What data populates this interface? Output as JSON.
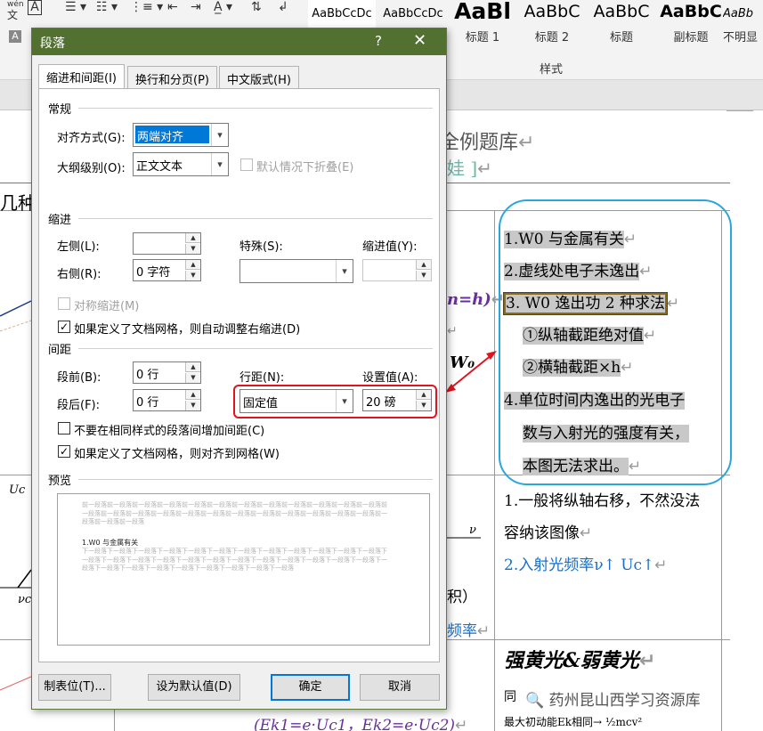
{
  "ribbon": {
    "wen_char": "wén",
    "wen_char_sub": "文",
    "a_char": "A",
    "styles_group_label": "样式",
    "styles": [
      {
        "sample": "AaBbCcDc",
        "name": ""
      },
      {
        "sample": "AaBbCcDc",
        "name": ""
      },
      {
        "sample": "AaBl",
        "name": "标题 1"
      },
      {
        "sample": "AaBbC",
        "name": "标题 2"
      },
      {
        "sample": "AaBbC",
        "name": "标题"
      },
      {
        "sample": "AaBbC",
        "name": "副标题"
      },
      {
        "sample": "AaBb",
        "name": "不明显"
      }
    ]
  },
  "dialog": {
    "title": "段落",
    "help": "?",
    "close": "✕",
    "tabs": [
      "缩进和间距(I)",
      "换行和分页(P)",
      "中文版式(H)"
    ],
    "general": {
      "section": "常规",
      "alignment_label": "对齐方式(G):",
      "alignment_value": "两端对齐",
      "outline_label": "大纲级别(O):",
      "outline_value": "正文文本",
      "collapse_label": "默认情况下折叠(E)"
    },
    "indent": {
      "section": "缩进",
      "left_label": "左侧(L):",
      "left_value": "",
      "right_label": "右侧(R):",
      "right_value": "0 字符",
      "special_label": "特殊(S):",
      "special_value": "",
      "by_label": "缩进值(Y):",
      "by_value": "",
      "mirror_label": "对称缩进(M)",
      "auto_adjust_label": "如果定义了文档网格，则自动调整右缩进(D)"
    },
    "spacing": {
      "section": "间距",
      "before_label": "段前(B):",
      "before_value": "0 行",
      "after_label": "段后(F):",
      "after_value": "0 行",
      "line_spacing_label": "行距(N):",
      "line_spacing_value": "固定值",
      "at_label": "设置值(A):",
      "at_value": "20 磅",
      "no_space_label": "不要在相同样式的段落间增加间距(C)",
      "snap_grid_label": "如果定义了文档网格，则对齐到网格(W)"
    },
    "preview": {
      "section": "预览",
      "prev_text": "前一段落前一段落前一段落前一段落前一段落前一段落前一段落前一段落前一段落前一段落前一段落前一段落前一段落前一段落前一段落前一段落前一段落前一段落前一段落前一段落前一段落前一段落前一段落前一段落前一段落前一段落前一段落",
      "sample_text": "1.W0 与金属有关",
      "next_text": "下一段落下一段落下一段落下一段落下一段落下一段落下一段落下一段落下一段落下一段落下一段落下一段落下一段落下一段落下一段落下一段落下一段落下一段落下一段落下一段落下一段落下一段落下一段落下一段落下一段落下一段落下一段落下一段落下一段落下一段落下一段落下一段落下一段落"
    },
    "buttons": {
      "tabs": "制表位(T)...",
      "default": "设为默认值(D)",
      "ok": "确定",
      "cancel": "取消"
    }
  },
  "document": {
    "heading_partial": "全例题库",
    "sub_partial": "娃 ]",
    "left_fragment": "几种",
    "formula_a": "n=h)",
    "formula_b": "W₀",
    "axis_v": "ν",
    "axis_u": "Uc",
    "axis_vc": "νc",
    "frag_ji": "积）",
    "frag_pinlv": "频率",
    "cell1": [
      "1.W0 与金属有关",
      "2.虚线处电子未逸出",
      "3. W0 逸出功 2 种求法",
      "①纵轴截距绝对值",
      "②横轴截距×h",
      "4.单位时间内逸出的光电子",
      "数与入射光的强度有关，",
      "本图无法求出。"
    ],
    "cell2": [
      "1.一般将纵轴右移，不然没法",
      "容纳该图像",
      "2.入射光频率ν↑ Uc↑"
    ],
    "cell3_title": "强黄光&弱黄光",
    "cell3_line": "最大初动能Ek相同→ ½mcv²",
    "cell3_partial": "同",
    "formula_bottom": "(Ek1=e·Uc1，Ek2=e·Uc2)"
  },
  "watermark": "🔍 药州昆山西学习资源库",
  "colors": {
    "titlebar": "#52702f",
    "highlight_red": "#e0141e",
    "highlight_blue": "#2aa6dd",
    "selection": "#0078d7",
    "doc_blue": "#1a6fc4"
  }
}
